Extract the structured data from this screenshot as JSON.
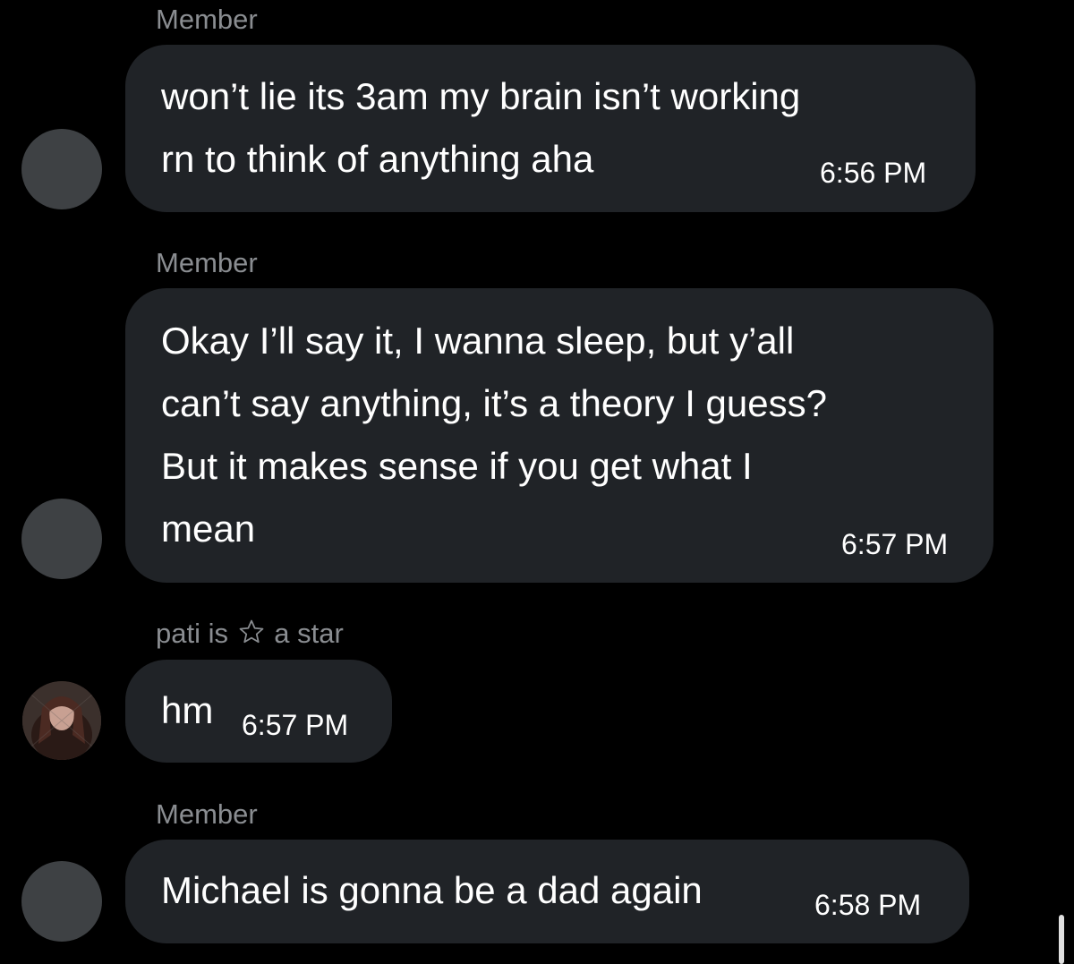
{
  "messages": [
    {
      "sender": "Member",
      "text": "won’t lie its 3am my brain isn’t working\nrn to think of anything aha",
      "time": "6:56 PM"
    },
    {
      "sender": "Member",
      "text": "Okay I’ll say it, I wanna sleep, but y’all\ncan’t say anything, it’s a theory I guess?\nBut it makes sense if you get what I\nmean",
      "time": "6:57 PM"
    },
    {
      "sender_prefix": "pati is",
      "sender_suffix": "a star",
      "text": "hm",
      "time": "6:57 PM"
    },
    {
      "sender": "Member",
      "text": "Michael is gonna be a dad again",
      "time": "6:58 PM"
    }
  ],
  "icons": {
    "sender_decoration": "star-outline-icon"
  },
  "colors": {
    "background": "#000000",
    "bubble": "#202327",
    "avatar_placeholder": "#3e4144",
    "sender_name": "#8a8d91",
    "text": "#ffffff"
  }
}
